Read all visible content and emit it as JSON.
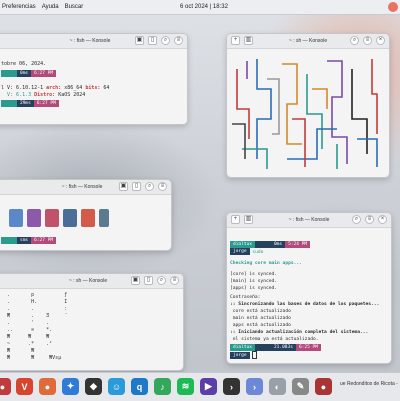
{
  "topbar": {
    "menu": [
      "Preferencias",
      "Ayuda",
      "Buscar"
    ],
    "clock": "6 oct 2024 | 18:32"
  },
  "colors": {
    "accent": "#2b9a8f",
    "secondary": "#26415e",
    "pink": "#b24a7a",
    "error": "#c23b3b"
  },
  "windows": {
    "w1": {
      "title": "~ : fish — Konsole",
      "line1": "tobre 06, 2024.",
      "seg1": "0ms",
      "seg2": "6:27 PM",
      "kernel_pre": "l V: 6.10.12-1 ",
      "arch_lbl": "arch:",
      "arch_val": " x86_64 ",
      "bits_lbl": "bits:",
      "bits_val": " 64",
      "ver_pre": "  V: 6.1.3 ",
      "distro_lbl": "Distro:",
      "distro_val": " KaOS 2024",
      "seg3": "29ms",
      "seg4": "6:27 PM"
    },
    "w2": {
      "title": "~ : sh — Konsole"
    },
    "w3": {
      "title": "~ : fish — Konsole",
      "seg1": "sms",
      "seg2": "6:27 PM"
    },
    "w4": {
      "title": "~ : sh — Konsole",
      "rows": [
        "  .       p          ƒ",
        "  .       H.         I",
        "  .       .          :",
        "  ₩       .    Ʒ     ¨",
        "  .       '    .     ",
        "  ..      ∞    *.    ",
        "  ₩      ₩     ₩     ",
        "  ~      .*    .ᴵ    ",
        "  ₩       ₩          ",
        "  ₩       ₩     ₩Vsµ "
      ]
    },
    "w5": {
      "title": "~ : fish — Konsole",
      "prompt_dir": "dialtux",
      "prompt_time1": "0ms",
      "prompt_clock1": "5:24 PM",
      "prompt_user": "jorge",
      "cmd": "sudo",
      "checking": "Checking core main apps...",
      "core": "[core] is synced.",
      "main": "[main] is synced.",
      "apps": "[apps] is synced.",
      "pw": "Contraseña:",
      "sync1": ":: Sincronizando las bases de datos de los paquetes...",
      "s1": " core está actualizado",
      "s2": " main está actualizado",
      "s3": " apps está actualizado",
      "upd": ":: Iniciando actualización completa del sistema...",
      "upd2": " el sistema ya está actualizado.",
      "prompt_time2": "21.083s",
      "prompt_clock2": "6:25 PM"
    }
  },
  "dock": {
    "media_text": "ue Redonditos de Ricota -"
  }
}
